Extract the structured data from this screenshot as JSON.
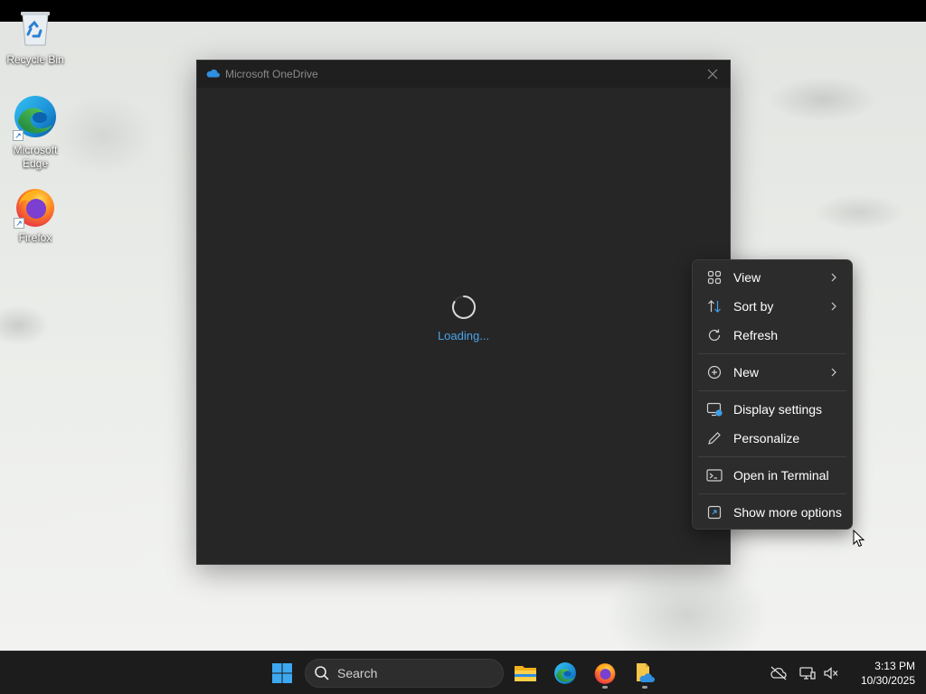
{
  "desktop": {
    "icons": [
      {
        "label": "Recycle Bin",
        "icon": "recycle-bin-icon"
      },
      {
        "label": "Microsoft Edge",
        "icon": "edge-icon"
      },
      {
        "label": "Firefox",
        "icon": "firefox-icon"
      }
    ]
  },
  "window": {
    "title": "Microsoft OneDrive",
    "app_icon": "onedrive-cloud-icon",
    "loading_text": "Loading..."
  },
  "context_menu": {
    "items": [
      {
        "label": "View",
        "icon": "grid-view-icon",
        "submenu": true
      },
      {
        "label": "Sort by",
        "icon": "sort-icon",
        "submenu": true
      },
      {
        "label": "Refresh",
        "icon": "refresh-icon",
        "submenu": false
      },
      {
        "label": "New",
        "icon": "plus-circle-icon",
        "submenu": true
      },
      {
        "label": "Display settings",
        "icon": "display-settings-icon",
        "submenu": false
      },
      {
        "label": "Personalize",
        "icon": "pencil-icon",
        "submenu": false
      },
      {
        "label": "Open in Terminal",
        "icon": "terminal-icon",
        "submenu": false
      },
      {
        "label": "Show more options",
        "icon": "more-options-icon",
        "submenu": false
      }
    ]
  },
  "taskbar": {
    "search_placeholder": "Search",
    "apps": [
      "start-icon",
      "file-explorer-icon",
      "edge-icon",
      "firefox-icon",
      "onedrive-setup-icon"
    ],
    "tray": [
      "onedrive-offline-icon",
      "network-icon",
      "volume-muted-icon"
    ],
    "time": "3:13 PM",
    "date": "10/30/2025"
  },
  "colors": {
    "accent": "#4aa3ea",
    "window_bg": "#262626",
    "menu_bg": "#2c2c2c",
    "taskbar_bg": "#1c1c1c"
  }
}
